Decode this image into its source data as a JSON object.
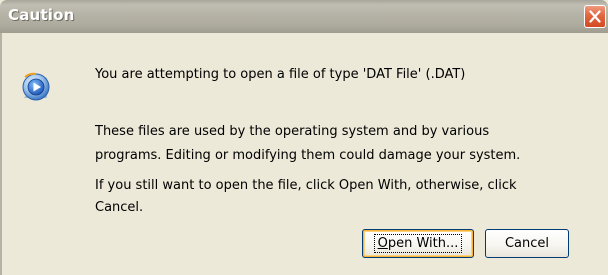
{
  "dialog": {
    "title": "Caution",
    "message_lines": [
      "You are attempting to open a file of type 'DAT File' (.DAT)",
      "These files are used by the operating system and by various",
      "programs. Editing or modifying them could damage your system.",
      "If you still want to open the file, click Open With, otherwise, click",
      "Cancel."
    ],
    "buttons": {
      "open_with_mnemonic": "O",
      "open_with_rest": "pen With...",
      "cancel": "Cancel"
    },
    "icons": {
      "close": "close-icon",
      "app": "media-player-icon"
    },
    "colors": {
      "titlebar": "#b5b2a6",
      "close_button": "#e2663f",
      "dialog_background": "#ece9d8",
      "button_border": "#003c74",
      "default_button_glow": "#f8b33a"
    }
  }
}
